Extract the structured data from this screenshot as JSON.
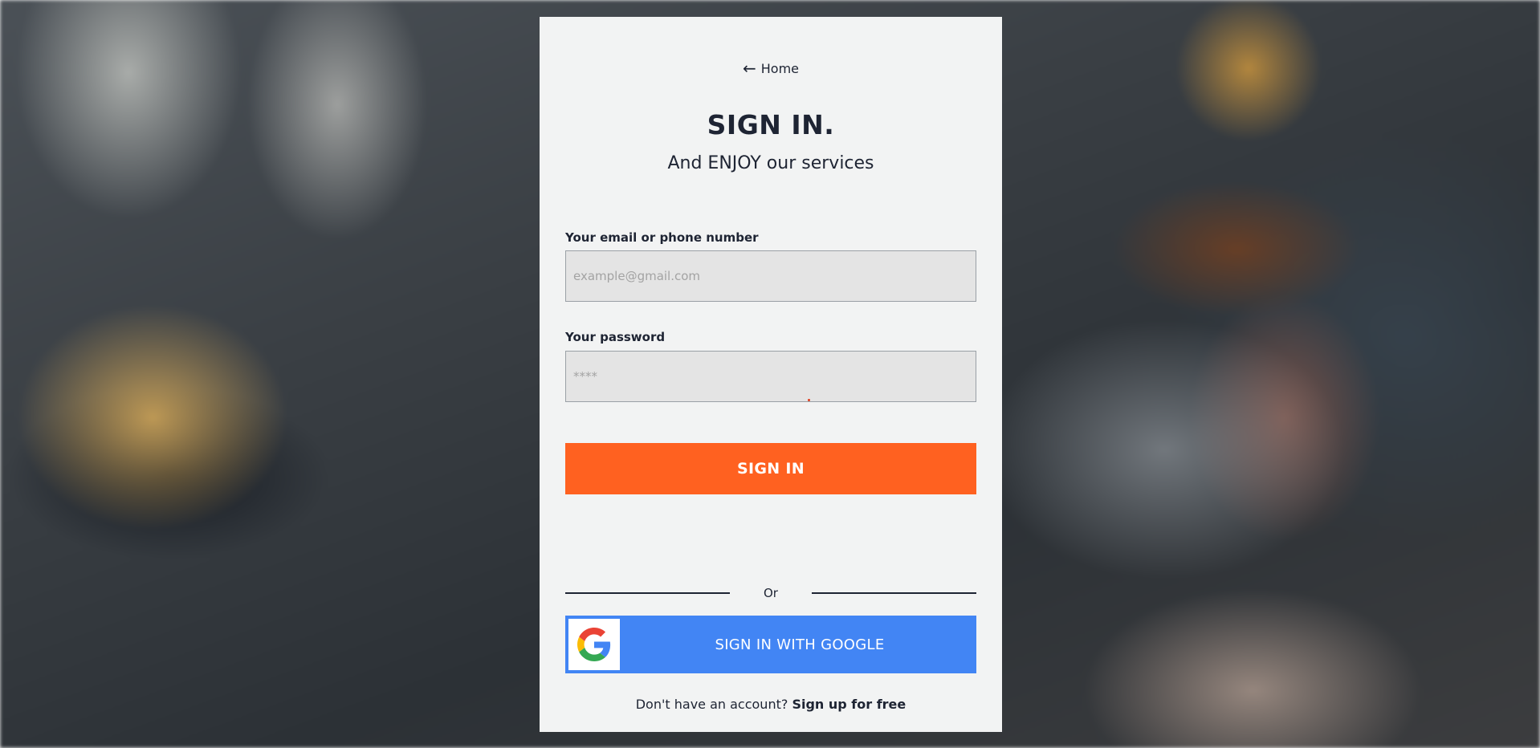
{
  "background": {
    "description_icon": "restaurant-photo"
  },
  "colors": {
    "primary_button": "#ff6120",
    "google_button": "#4285f4",
    "card_background": "#f2f3f3",
    "text": "#1e2433"
  },
  "nav": {
    "back_icon": "arrow-left-icon",
    "home_label": "Home"
  },
  "header": {
    "title": "SIGN IN.",
    "subtitle": "And ENJOY our services"
  },
  "form": {
    "email": {
      "label": "Your email or phone number",
      "placeholder": "example@gmail.com",
      "value": ""
    },
    "password": {
      "label": "Your password",
      "placeholder": "****",
      "value": ""
    },
    "submit_label": "SIGN IN"
  },
  "divider": {
    "label": "Or"
  },
  "google": {
    "icon": "google-icon",
    "label": "SIGN IN WITH GOOGLE"
  },
  "signup": {
    "prompt": "Don't have an account?",
    "link_label": "Sign up for free"
  }
}
